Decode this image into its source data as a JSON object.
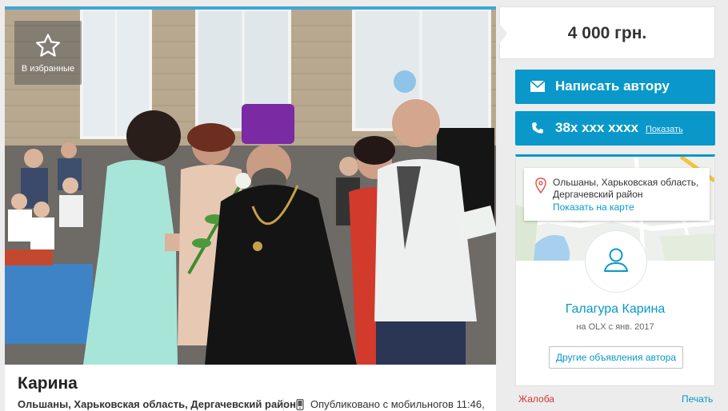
{
  "listing": {
    "title": "Карина",
    "location": "Ольшаны, Харьковская область, Дергачевский район",
    "published": "Опубликовано с мобильного",
    "published_time": "в 11:46,",
    "favorite_label": "В избранные"
  },
  "price": {
    "value": "4 000 грн."
  },
  "actions": {
    "write_label": "Написать автору",
    "phone_masked": "38x xxx xxxx",
    "phone_show": "Показать"
  },
  "seller": {
    "address": "Ольшаны, Харьковская область, Дергачевский район",
    "map_link": "Показать на карте",
    "name": "Галагура Карина",
    "since": "на OLX с янв. 2017",
    "other_ads": "Другие объявления автора"
  },
  "footer": {
    "complaint": "Жалоба",
    "print": "Печать"
  },
  "colors": {
    "accent": "#0998c9",
    "complaint": "#d43737",
    "background": "#ececec"
  },
  "icons": [
    "star-icon",
    "phone-icon",
    "mail-icon",
    "map-pin-icon",
    "user-icon"
  ]
}
